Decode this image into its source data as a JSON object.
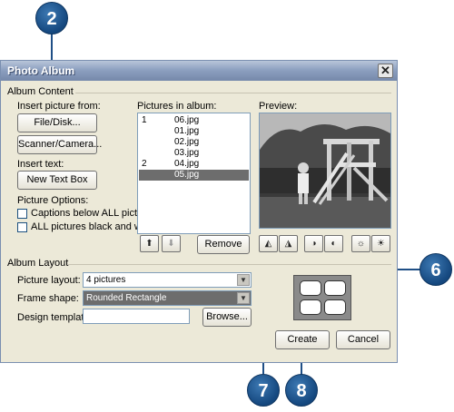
{
  "window": {
    "title": "Photo Album",
    "close_label": "✕"
  },
  "album_content": {
    "group_label": "Album Content",
    "insert_picture_label": "Insert picture from:",
    "file_disk_button": "File/Disk...",
    "scanner_camera_button": "Scanner/Camera...",
    "insert_text_label": "Insert text:",
    "new_text_box_button": "New Text Box",
    "picture_options_label": "Picture Options:",
    "captions_option": "Captions below ALL pictures",
    "black_white_option": "ALL pictures black and white",
    "captions_checked": false,
    "black_white_checked": false
  },
  "pictures": {
    "label": "Pictures in album:",
    "rows": [
      {
        "num": "1",
        "file": "06.jpg",
        "selected": false
      },
      {
        "num": "",
        "file": "01.jpg",
        "selected": false
      },
      {
        "num": "",
        "file": "02.jpg",
        "selected": false
      },
      {
        "num": "",
        "file": "03.jpg",
        "selected": false
      },
      {
        "num": "2",
        "file": "04.jpg",
        "selected": false
      },
      {
        "num": "",
        "file": "05.jpg",
        "selected": true
      }
    ],
    "move_up_icon": "move-up-icon",
    "move_down_icon": "move-down-icon",
    "remove_button": "Remove"
  },
  "preview": {
    "label": "Preview:",
    "tools": [
      "rotate-left-icon",
      "rotate-right-icon",
      "contrast-up-icon",
      "contrast-down-icon",
      "brightness-up-icon",
      "brightness-down-icon"
    ]
  },
  "album_layout": {
    "group_label": "Album Layout",
    "picture_layout_label": "Picture layout:",
    "picture_layout_value": "4 pictures",
    "frame_shape_label": "Frame shape:",
    "frame_shape_value": "Rounded Rectangle",
    "design_template_label": "Design template:",
    "design_template_value": "",
    "browse_button": "Browse..."
  },
  "buttons": {
    "create": "Create",
    "cancel": "Cancel"
  },
  "callouts": {
    "c2": "2",
    "c6": "6",
    "c7": "7",
    "c8": "8"
  },
  "colors": {
    "dialog_bg": "#ece9d8",
    "selection": "#6d6d6d",
    "callout": "#1f4f86"
  }
}
